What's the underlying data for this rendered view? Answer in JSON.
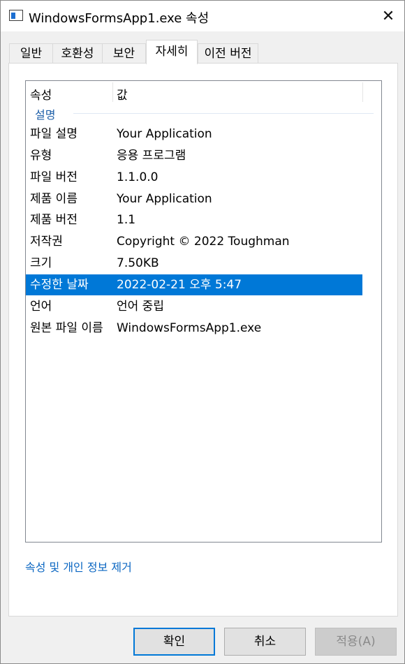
{
  "window": {
    "title": "WindowsFormsApp1.exe 속성",
    "close_glyph": "✕"
  },
  "tabs": [
    {
      "label": "일반"
    },
    {
      "label": "호환성"
    },
    {
      "label": "보안"
    },
    {
      "label": "자세히",
      "active": true
    },
    {
      "label": "이전 버전"
    }
  ],
  "details": {
    "columns": {
      "property": "속성",
      "value": "값"
    },
    "group": "설명",
    "rows": [
      {
        "property": "파일 설명",
        "value": "Your Application"
      },
      {
        "property": "유형",
        "value": "응용 프로그램"
      },
      {
        "property": "파일 버전",
        "value": "1.1.0.0"
      },
      {
        "property": "제품 이름",
        "value": "Your Application"
      },
      {
        "property": "제품 버전",
        "value": "1.1"
      },
      {
        "property": "저작권",
        "value": "Copyright ©  2022 Toughman"
      },
      {
        "property": "크기",
        "value": "7.50KB"
      },
      {
        "property": "수정한 날짜",
        "value": "2022-02-21 오후 5:47",
        "selected": true
      },
      {
        "property": "언어",
        "value": "언어 중립"
      },
      {
        "property": "원본 파일 이름",
        "value": "WindowsFormsApp1.exe"
      }
    ]
  },
  "remove_link": "속성 및 개인 정보 제거",
  "buttons": {
    "ok": "확인",
    "cancel": "취소",
    "apply": "적용(A)"
  },
  "colors": {
    "selection": "#0078d7",
    "link": "#0a66c2",
    "group_header": "#1e5fa8"
  }
}
